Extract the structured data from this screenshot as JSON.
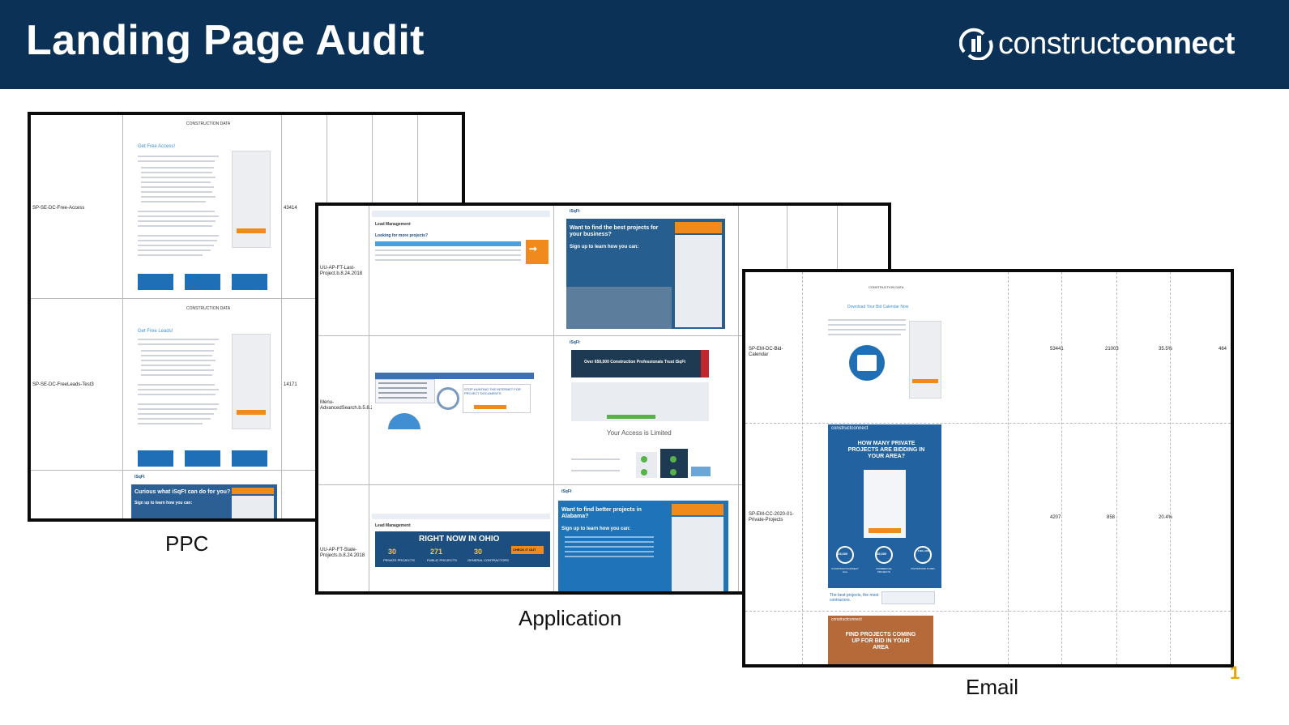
{
  "header": {
    "title": "Landing Page Audit",
    "logo_light": "construct",
    "logo_bold": "connect",
    "logo_icon": "construct-connect-logo-icon",
    "background_color": "#0b3256"
  },
  "panels": {
    "ppc": {
      "caption": "PPC",
      "rows": [
        {
          "label": "SP-SE-DC-Free-Access",
          "value": "43414",
          "thumb_heading": "Get Free Access!"
        },
        {
          "label": "SP-SE-DC-FreeLeads-Test3",
          "value": "14171",
          "thumb_heading": "Get Free Leads!"
        },
        {
          "label": "",
          "value": "",
          "thumb_heading": "Curious what iSqFt can do for you?"
        }
      ],
      "thumb_brand": "CONSTRUCTION DATA",
      "thumb_sub": "Sign up to learn how you can:"
    },
    "application": {
      "caption": "Application",
      "rows": [
        {
          "label": "UU-AP-FT-Last-Project.b.8.24.2018",
          "thumb_left": "Looking for more projects?",
          "thumb_right": "Want to find the best projects for your business?"
        },
        {
          "label": "Menu-AdvancedSearch.b.5.8.2018",
          "thumb_left": "STOP HUNTING THE INTERNET FOR PROJECT DOCUMENTS",
          "thumb_right": "Over 650,000 Construction Professionals Trust iSqFt"
        },
        {
          "label": "UU-AP-FT-State-Projects.b.8.24.2018",
          "thumb_left": "RIGHT NOW IN OHIO",
          "thumb_right": "Want to find better projects in Alabama?"
        }
      ],
      "ohio_stats": [
        {
          "num": "30",
          "label": "PRIVATE PROJECTS"
        },
        {
          "num": "271",
          "label": "PUBLIC PROJECTS"
        },
        {
          "num": "30",
          "label": "GENERAL CONTRACTORS"
        }
      ],
      "check_it_out": "CHECK IT OUT",
      "access_limited": "Your Access is Limited",
      "isqft_brand": "iSqFt"
    },
    "email": {
      "caption": "Email",
      "rows": [
        {
          "label": "SP-EM-DC-Bid-Calendar",
          "values": [
            "53441",
            "21003",
            "35.5%",
            "464"
          ],
          "thumb_heading": "Download Your Bid Calendar Now"
        },
        {
          "label": "SP-EM-CC-2020-01-Private-Projects",
          "values": [
            "4207",
            "858",
            "20.4%",
            ""
          ],
          "thumb_heading": "HOW MANY PRIVATE PROJECTS ARE BIDDING IN YOUR AREA?"
        },
        {
          "label": "",
          "values": [
            "",
            "",
            "",
            ""
          ],
          "thumb_heading": "FIND PROJECTS COMING UP FOR BID IN YOUR AREA"
        }
      ],
      "stats": [
        {
          "num": "25,000",
          "label": "CONSTRUCTCONNECT GCs"
        },
        {
          "num": "35,000",
          "label": "COMMERCIAL PROJECTS"
        },
        {
          "num": "6 BILLION",
          "label": "INVITATIONS TO BID"
        }
      ],
      "thumb_footer": "The best projects, the most contractors.",
      "thumb_brand": "constructconnect"
    }
  },
  "page_number": "1",
  "colors": {
    "accent_orange": "#f08a1c",
    "thumb_blue": "#1d5e97",
    "page_number": "#e8a500"
  }
}
